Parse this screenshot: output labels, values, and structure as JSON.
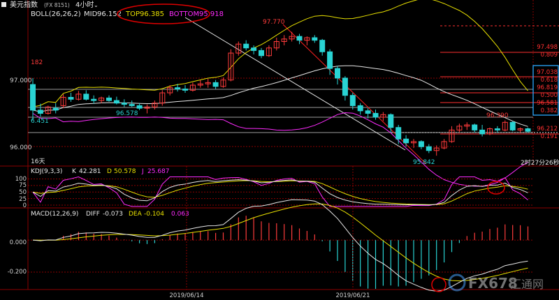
{
  "header": {
    "instrument": "美元指数",
    "code": "(FX 8151)",
    "timeframe": "4小时",
    "watermark": "FX678",
    "watermark_cn": "汇通网"
  },
  "colors": {
    "bg": "#000000",
    "up": "#ff3b3b",
    "down": "#29d3d3",
    "white": "#e8e8e8",
    "yellow": "#e8e000",
    "magenta": "#ff2bff",
    "red": "#ff2020",
    "grid": "#8b0000",
    "annot_red": "#e00000",
    "axis_text": "#d0d0d0",
    "box_blue": "#2aa8ff"
  },
  "chart_data": [
    {
      "type": "candlestick",
      "title": "BOLL(26,26,2)",
      "indicator_values": [
        {
          "label": "MID",
          "value": "96.152"
        },
        {
          "label": "TOP",
          "value": "96.385"
        },
        {
          "label": "BOTTOM",
          "value": "95.918"
        }
      ],
      "y_ticks": [
        "97.000",
        "96.000"
      ],
      "x_ticks": [
        "2019/06/14",
        "2019/06/21"
      ],
      "annotations": {
        "high_label": "97.770",
        "left_high": "182",
        "left_low": "6.451",
        "mid_low": "96.578",
        "recent_high": "96.390",
        "recent_low": "95.842",
        "period_label": "16天",
        "countdown": "2时27分26秒"
      },
      "fib_levels": [
        "97.498",
        "0.809",
        "97.038",
        "0.618",
        "96.819",
        "0.500",
        "96.581",
        "0.382",
        "96.212",
        "0.191"
      ],
      "ylim": [
        95.7,
        98.05
      ],
      "candles": [
        [
          96.95,
          97.05,
          96.4,
          96.55
        ],
        [
          96.55,
          96.65,
          96.45,
          96.5
        ],
        [
          96.5,
          96.62,
          96.48,
          96.6
        ],
        [
          96.58,
          96.66,
          96.5,
          96.55
        ],
        [
          96.62,
          96.8,
          96.58,
          96.75
        ],
        [
          96.75,
          96.82,
          96.68,
          96.72
        ],
        [
          96.72,
          96.85,
          96.7,
          96.8
        ],
        [
          96.8,
          96.86,
          96.7,
          96.72
        ],
        [
          96.72,
          96.78,
          96.65,
          96.7
        ],
        [
          96.7,
          96.76,
          96.66,
          96.74
        ],
        [
          96.74,
          96.78,
          96.68,
          96.7
        ],
        [
          96.7,
          96.76,
          96.64,
          96.66
        ],
        [
          96.66,
          96.72,
          96.6,
          96.64
        ],
        [
          96.64,
          96.7,
          96.6,
          96.62
        ],
        [
          96.62,
          96.66,
          96.55,
          96.58
        ],
        [
          96.58,
          96.64,
          96.5,
          96.6
        ],
        [
          96.6,
          96.7,
          96.56,
          96.66
        ],
        [
          96.66,
          96.86,
          96.62,
          96.82
        ],
        [
          96.82,
          96.94,
          96.78,
          96.9
        ],
        [
          96.9,
          96.96,
          96.84,
          96.88
        ],
        [
          96.88,
          96.94,
          96.82,
          96.86
        ],
        [
          96.86,
          96.98,
          96.84,
          96.94
        ],
        [
          96.94,
          97.02,
          96.9,
          96.96
        ],
        [
          96.96,
          97.04,
          96.9,
          96.98
        ],
        [
          96.98,
          97.02,
          96.88,
          96.92
        ],
        [
          96.92,
          97.06,
          96.9,
          97.02
        ],
        [
          97.02,
          97.5,
          97.0,
          97.44
        ],
        [
          97.44,
          97.62,
          97.4,
          97.58
        ],
        [
          97.58,
          97.64,
          97.48,
          97.52
        ],
        [
          97.52,
          97.56,
          97.42,
          97.48
        ],
        [
          97.48,
          97.52,
          97.36,
          97.4
        ],
        [
          97.4,
          97.56,
          97.38,
          97.52
        ],
        [
          97.52,
          97.68,
          97.48,
          97.62
        ],
        [
          97.62,
          97.72,
          97.56,
          97.66
        ],
        [
          97.66,
          97.77,
          97.62,
          97.7
        ],
        [
          97.7,
          97.74,
          97.58,
          97.64
        ],
        [
          97.64,
          97.7,
          97.56,
          97.68
        ],
        [
          97.68,
          97.72,
          97.6,
          97.64
        ],
        [
          97.64,
          97.66,
          97.4,
          97.46
        ],
        [
          97.46,
          97.5,
          97.1,
          97.2
        ],
        [
          97.2,
          97.24,
          96.95,
          97.05
        ],
        [
          97.05,
          97.08,
          96.7,
          96.78
        ],
        [
          96.78,
          96.82,
          96.56,
          96.62
        ],
        [
          96.62,
          96.66,
          96.48,
          96.54
        ],
        [
          96.54,
          96.58,
          96.42,
          96.5
        ],
        [
          96.5,
          96.56,
          96.4,
          96.44
        ],
        [
          96.44,
          96.52,
          96.38,
          96.48
        ],
        [
          96.48,
          96.5,
          96.2,
          96.28
        ],
        [
          96.28,
          96.32,
          96.02,
          96.1
        ],
        [
          96.1,
          96.16,
          95.98,
          96.04
        ],
        [
          96.04,
          96.1,
          95.96,
          96.06
        ],
        [
          96.06,
          96.08,
          95.94,
          95.98
        ],
        [
          95.98,
          96.02,
          95.88,
          95.92
        ],
        [
          95.92,
          96.0,
          95.84,
          95.96
        ],
        [
          95.96,
          96.1,
          95.94,
          96.06
        ],
        [
          96.06,
          96.3,
          96.04,
          96.24
        ],
        [
          96.24,
          96.34,
          96.2,
          96.3
        ],
        [
          96.3,
          96.36,
          96.24,
          96.32
        ],
        [
          96.32,
          96.34,
          96.2,
          96.24
        ],
        [
          96.24,
          96.32,
          96.14,
          96.18
        ],
        [
          96.18,
          96.28,
          96.16,
          96.26
        ],
        [
          96.26,
          96.3,
          96.2,
          96.24
        ],
        [
          96.24,
          96.39,
          96.22,
          96.36
        ],
        [
          96.36,
          96.38,
          96.22,
          96.24
        ],
        [
          96.24,
          96.28,
          96.2,
          96.26
        ],
        [
          96.26,
          96.28,
          96.2,
          96.22
        ]
      ]
    },
    {
      "type": "line",
      "title": "KDJ(9,3,3)",
      "indicator_values": [
        {
          "label": "K",
          "value": "42.281"
        },
        {
          "label": "D",
          "value": "50.578"
        },
        {
          "label": "J",
          "value": "25.687"
        }
      ],
      "y_ticks": [
        "100",
        "75",
        "50",
        "25",
        "0"
      ],
      "ylim": [
        -8,
        112
      ]
    },
    {
      "type": "bar",
      "title": "MACD(12,26,9)",
      "indicator_values": [
        {
          "label": "DIFF",
          "value": "-0.073"
        },
        {
          "label": "DEA",
          "value": "-0.104"
        },
        {
          "label": "",
          "value": "0.063"
        }
      ],
      "y_ticks": [
        "0.000",
        "-0.200"
      ],
      "ylim": [
        -0.3,
        0.14
      ]
    }
  ]
}
